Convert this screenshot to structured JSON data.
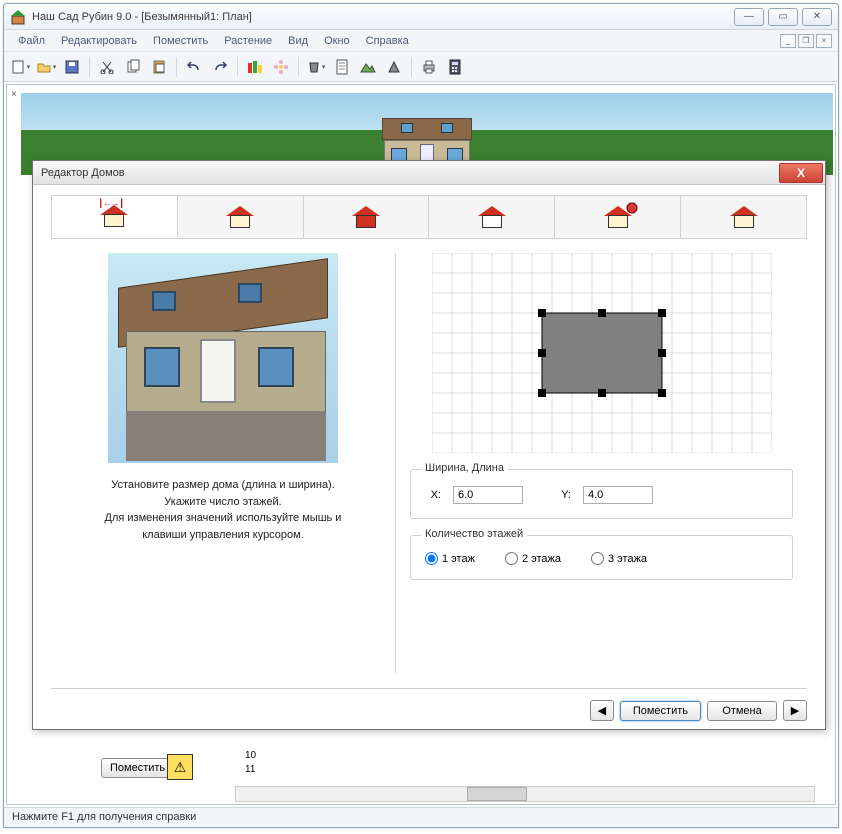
{
  "app": {
    "title": "Наш Сад Рубин 9.0 -  [Безымянный1: План]"
  },
  "menu": [
    "Файл",
    "Редактировать",
    "Поместить",
    "Растение",
    "Вид",
    "Окно",
    "Справка"
  ],
  "bottom": {
    "place": "Поместить",
    "tick1": "10",
    "tick2": "11"
  },
  "status": "Нажмите F1 для получения справки",
  "dialog": {
    "title": "Редактор Домов",
    "hint1": "Установите размер дома (длина и ширина).",
    "hint2": "Укажите число этажей.",
    "hint3": "Для изменения значений используйте мышь и",
    "hint4": "клавиши управления курсором.",
    "dims_legend": "Ширина, Длина",
    "x_label": "X:",
    "y_label": "Y:",
    "x_value": "6.0",
    "y_value": "4.0",
    "floors_legend": "Количество этажей",
    "floor1": "1 этаж",
    "floor2": "2 этажа",
    "floor3": "3 этажа",
    "place": "Поместить",
    "cancel": "Отмена"
  }
}
